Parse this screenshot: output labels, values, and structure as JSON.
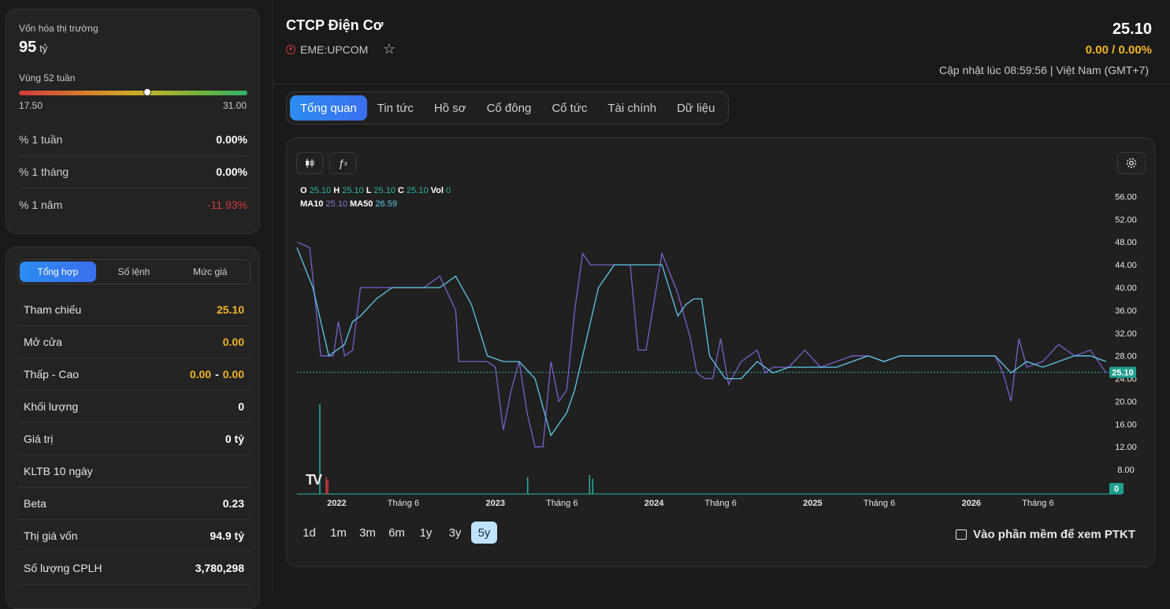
{
  "market_cap": {
    "label": "Vốn hóa thị trường",
    "value": "95",
    "unit": "tỷ",
    "range_label": "Vùng 52 tuần",
    "range_min": "17.50",
    "range_max": "31.00",
    "range_position": 0.563
  },
  "performance": [
    {
      "label": "% 1 tuần",
      "value": "0.00%"
    },
    {
      "label": "% 1 tháng",
      "value": "0.00%"
    },
    {
      "label": "% 1 năm",
      "value": "-11.93%"
    }
  ],
  "summary_tabs": [
    "Tổng hợp",
    "Số lệnh",
    "Mức giá"
  ],
  "summary": {
    "tham_chieu": {
      "label": "Tham chiếu",
      "value": "25.10"
    },
    "mo_cua": {
      "label": "Mở cửa",
      "value": "0.00"
    },
    "thap_cao": {
      "label": "Thấp - Cao",
      "low": "0.00",
      "sep": "-",
      "high": "0.00"
    },
    "khoi_luong": {
      "label": "Khối lượng",
      "value": "0"
    },
    "gia_tri": {
      "label": "Giá trị",
      "value": "0 tỷ"
    },
    "kltb": {
      "label": "KLTB 10 ngày",
      "value": ""
    },
    "beta": {
      "label": "Beta",
      "value": "0.23"
    },
    "thi_gia_von": {
      "label": "Thị giá vốn",
      "value": "94.9 tỷ"
    },
    "so_luong": {
      "label": "Số lượng CPLH",
      "value": "3,780,298"
    }
  },
  "header": {
    "company": "CTCP Điện Cơ",
    "exchange": "EME:UPCOM",
    "price": "25.10",
    "change": "0.00 / 0.00%",
    "updated": "Cập nhật lúc 08:59:56 | Việt Nam (GMT+7)"
  },
  "tabs": [
    "Tổng quan",
    "Tin tức",
    "Hồ sơ",
    "Cổ đông",
    "Cổ tức",
    "Tài chính",
    "Dữ liệu"
  ],
  "chart_legend": {
    "o_label": "O",
    "o_val": "25.10",
    "h_label": "H",
    "h_val": "25.10",
    "l_label": "L",
    "l_val": "25.10",
    "c_label": "C",
    "c_val": "25.10",
    "vol_label": "Vol",
    "vol_val": "0",
    "ma10_label": "MA10",
    "ma10_val": "25.10",
    "ma50_label": "MA50",
    "ma50_val": "26.59"
  },
  "chart_data": {
    "type": "line",
    "title": "",
    "y_ticks": [
      "56.00",
      "52.00",
      "48.00",
      "44.00",
      "40.00",
      "36.00",
      "32.00",
      "28.00",
      "24.00",
      "20.00",
      "16.00",
      "12.00",
      "8.00"
    ],
    "ylim": [
      4,
      58
    ],
    "x_ticks": [
      "2022",
      "Tháng 6",
      "2023",
      "Tháng 6",
      "2024",
      "Tháng 6",
      "2025",
      "Tháng 6",
      "2026",
      "Tháng 6"
    ],
    "x_range": [
      2021.6,
      2026.7
    ],
    "current_price_label": "25.10",
    "volume_label": "0",
    "series": [
      {
        "name": "MA10",
        "color": "#7a5fc9",
        "x": [
          2021.6,
          2021.68,
          2021.75,
          2021.83,
          2021.86,
          2021.9,
          2021.95,
          2022.0,
          2022.1,
          2022.2,
          2022.3,
          2022.4,
          2022.5,
          2022.6,
          2022.62,
          2022.68,
          2022.75,
          2022.8,
          2022.85,
          2022.9,
          2022.95,
          2023.0,
          2023.05,
          2023.1,
          2023.15,
          2023.2,
          2023.25,
          2023.3,
          2023.35,
          2023.4,
          2023.45,
          2023.5,
          2023.55,
          2023.6,
          2023.65,
          2023.7,
          2023.75,
          2023.8,
          2023.9,
          2024.0,
          2024.08,
          2024.12,
          2024.17,
          2024.22,
          2024.27,
          2024.32,
          2024.4,
          2024.5,
          2024.55,
          2024.6,
          2024.7,
          2024.8,
          2024.9,
          2025.0,
          2025.1,
          2025.2,
          2025.3,
          2025.4,
          2025.5,
          2025.6,
          2025.7,
          2025.8,
          2025.9,
          2026.0,
          2026.05,
          2026.1,
          2026.15,
          2026.2,
          2026.3,
          2026.4,
          2026.5,
          2026.6,
          2026.7
        ],
        "values": [
          48,
          47,
          28,
          28,
          34,
          28,
          29,
          40,
          40,
          40,
          40,
          40,
          42,
          36,
          27,
          27,
          27,
          27,
          26,
          15,
          22,
          27,
          18,
          12,
          12,
          27,
          20,
          22,
          36,
          46,
          44,
          44,
          44,
          44,
          44,
          44,
          29,
          29,
          46,
          39,
          31,
          25,
          24,
          24,
          31,
          23,
          27,
          29,
          25,
          26,
          26,
          29,
          26,
          27,
          28,
          28,
          27,
          28,
          28,
          28,
          28,
          28,
          28,
          28,
          25,
          20,
          31,
          26,
          27,
          30,
          28,
          29,
          25
        ]
      },
      {
        "name": "MA50",
        "color": "#5fc6e8",
        "x": [
          2021.6,
          2021.7,
          2021.8,
          2021.9,
          2021.95,
          2022.0,
          2022.1,
          2022.2,
          2022.3,
          2022.4,
          2022.5,
          2022.6,
          2022.7,
          2022.8,
          2022.9,
          2023.0,
          2023.1,
          2023.15,
          2023.2,
          2023.3,
          2023.35,
          2023.4,
          2023.5,
          2023.6,
          2023.7,
          2023.8,
          2023.9,
          2024.0,
          2024.05,
          2024.1,
          2024.15,
          2024.2,
          2024.3,
          2024.4,
          2024.5,
          2024.6,
          2024.7,
          2024.8,
          2024.9,
          2025.0,
          2025.1,
          2025.2,
          2025.3,
          2025.4,
          2025.5,
          2025.6,
          2025.7,
          2025.8,
          2025.9,
          2026.0,
          2026.1,
          2026.2,
          2026.3,
          2026.4,
          2026.5,
          2026.6,
          2026.7
        ],
        "values": [
          47,
          40,
          28,
          30,
          34,
          35,
          38,
          40,
          40,
          40,
          40,
          42,
          37,
          28,
          27,
          27,
          24,
          19,
          14,
          18,
          22,
          28,
          40,
          44,
          44,
          44,
          44,
          35,
          37,
          38,
          38,
          28,
          24,
          24,
          27,
          25,
          26,
          26,
          26,
          26,
          27,
          28,
          27,
          28,
          28,
          28,
          28,
          28,
          28,
          28,
          25,
          27,
          26,
          27,
          28,
          28,
          27
        ]
      }
    ],
    "volume_bars": [
      {
        "x": 2021.74,
        "value": 0.95,
        "color": "#2ab0a8"
      },
      {
        "x": 2021.78,
        "value": 0.18,
        "color": "#d33b3b"
      },
      {
        "x": 2021.79,
        "value": 0.15,
        "color": "#d33b3b"
      },
      {
        "x": 2023.05,
        "value": 0.18,
        "color": "#2ab0a8"
      },
      {
        "x": 2023.44,
        "value": 0.2,
        "color": "#2ab0a8"
      },
      {
        "x": 2023.46,
        "value": 0.16,
        "color": "#2ab0a8"
      }
    ]
  },
  "range_buttons": [
    "1d",
    "1m",
    "3m",
    "6m",
    "1y",
    "3y",
    "5y"
  ],
  "active_range": "5y",
  "ptkt_label": "Vào phần mềm để xem PTKT",
  "tv_logo": "TV",
  "icons": {
    "candle": "candlestick-icon",
    "indicator": "fx-icon",
    "settings": "gear-icon",
    "star": "star-icon",
    "clock": "clock-icon",
    "external": "external-link-icon"
  },
  "colors": {
    "accent_blue": "#2c8cf0",
    "amber": "#f0b429",
    "negative": "#d33b3b",
    "teal": "#2ab0a8",
    "ma10": "#7a5fc9",
    "ma50": "#5fc6e8"
  }
}
